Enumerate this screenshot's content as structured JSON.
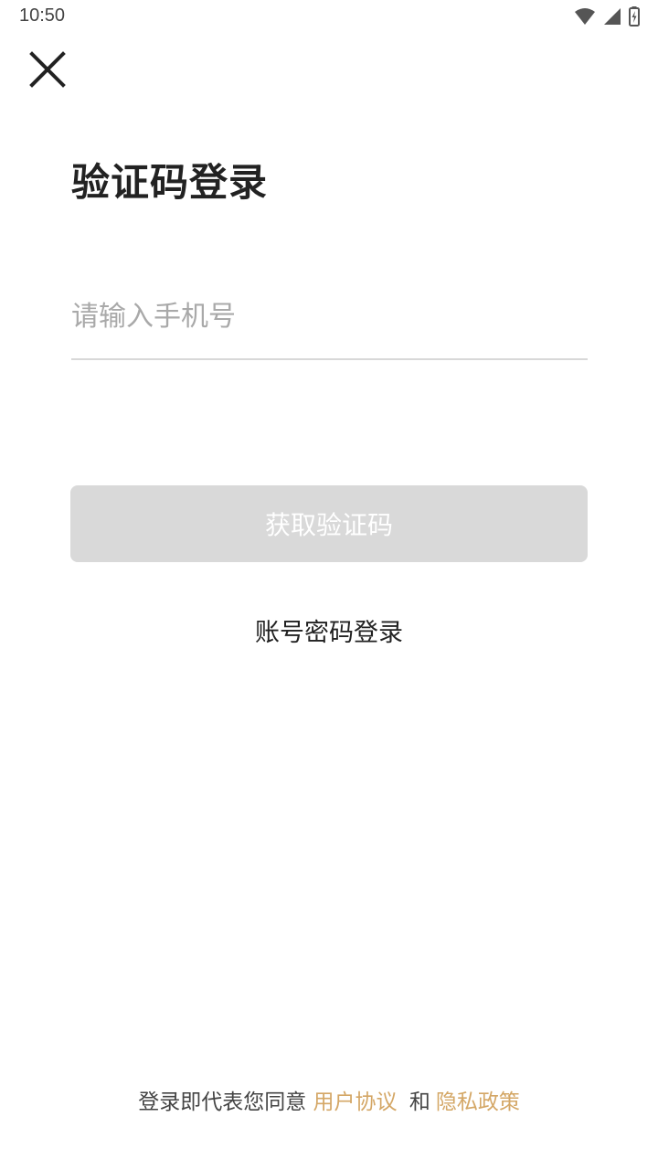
{
  "status_bar": {
    "time": "10:50"
  },
  "icons": {
    "wifi": "wifi-icon",
    "signal": "signal-icon",
    "battery": "battery-charging-icon",
    "close": "close-icon"
  },
  "login": {
    "title": "验证码登录",
    "phone_placeholder": "请输入手机号",
    "phone_value": "",
    "get_code_label": "获取验证码",
    "password_login_label": "账号密码登录"
  },
  "agreement": {
    "prefix": "登录即代表您同意",
    "user_agreement": "用户协议",
    "and": "和",
    "privacy_policy": "隐私政策"
  },
  "colors": {
    "button_disabled": "#d9d9d9",
    "link_accent": "#d4a766",
    "title": "#222222"
  }
}
